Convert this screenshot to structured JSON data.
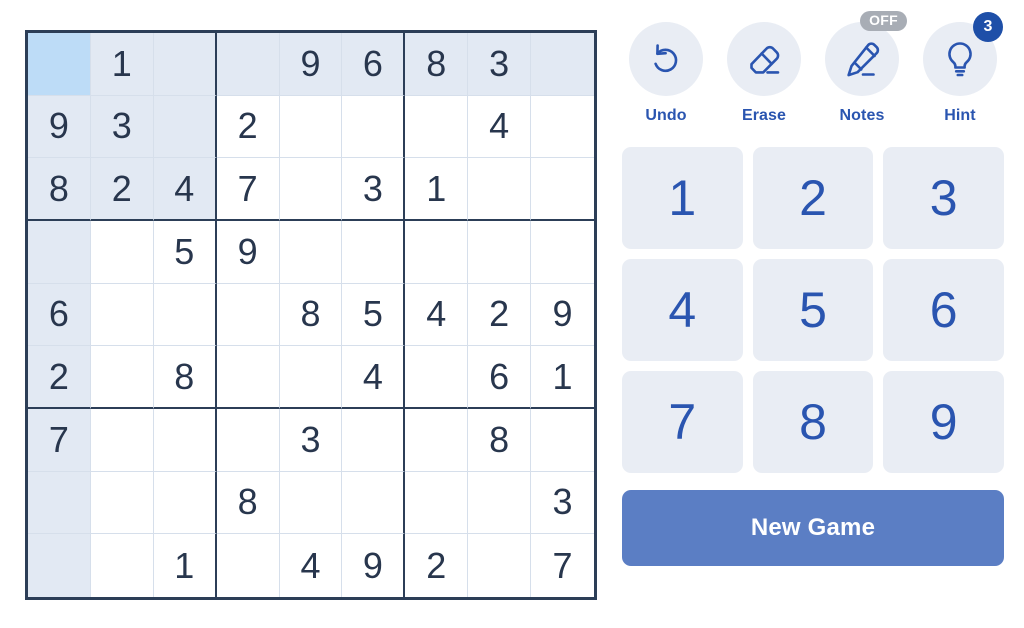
{
  "board": {
    "rows": [
      [
        "",
        "1",
        "",
        "",
        "9",
        "6",
        "8",
        "3",
        ""
      ],
      [
        "9",
        "3",
        "",
        "2",
        "",
        "",
        "",
        "4",
        ""
      ],
      [
        "8",
        "2",
        "4",
        "7",
        "",
        "3",
        "1",
        "",
        ""
      ],
      [
        "",
        "",
        "5",
        "9",
        "",
        "",
        "",
        "",
        ""
      ],
      [
        "6",
        "",
        "",
        "",
        "8",
        "5",
        "4",
        "2",
        "9"
      ],
      [
        "2",
        "",
        "8",
        "",
        "",
        "4",
        "",
        "6",
        "1"
      ],
      [
        "7",
        "",
        "",
        "",
        "3",
        "",
        "",
        "8",
        ""
      ],
      [
        "",
        "",
        "",
        "8",
        "",
        "",
        "",
        "",
        "3"
      ],
      [
        "",
        "",
        "1",
        "",
        "4",
        "9",
        "2",
        "",
        "7"
      ]
    ],
    "selected": {
      "row": 0,
      "col": 0
    },
    "colors": {
      "selected_cell": "#bddcf7",
      "highlight_cell": "#e2e9f3",
      "digit": "#28364d",
      "thick_line": "#2c3e57",
      "thin_line": "#d6dfeb"
    }
  },
  "actions": [
    {
      "id": "undo",
      "label": "Undo",
      "icon": "undo-arrow-icon",
      "badge": null,
      "badge_type": null
    },
    {
      "id": "erase",
      "label": "Erase",
      "icon": "eraser-icon",
      "badge": null,
      "badge_type": null
    },
    {
      "id": "notes",
      "label": "Notes",
      "icon": "pencil-icon",
      "badge": "OFF",
      "badge_type": "off"
    },
    {
      "id": "hint",
      "label": "Hint",
      "icon": "lightbulb-icon",
      "badge": "3",
      "badge_type": "count"
    }
  ],
  "numpad": {
    "keys": [
      "1",
      "2",
      "3",
      "4",
      "5",
      "6",
      "7",
      "8",
      "9"
    ]
  },
  "new_game": {
    "label": "New Game",
    "color": "#5b7ec4"
  },
  "theme": {
    "accent_blue": "#2a55b0",
    "button_bg": "#e9edf4",
    "badge_off_bg": "#a8adb5",
    "badge_count_bg": "#1e4fa8"
  }
}
